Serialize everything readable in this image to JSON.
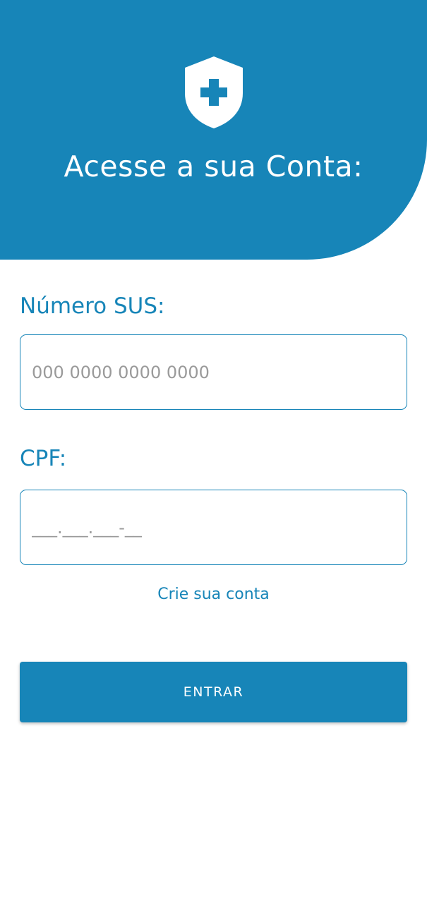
{
  "header": {
    "title": "Acesse a sua Conta:",
    "logo_icon": "shield-plus-icon"
  },
  "form": {
    "sus": {
      "label": "Número SUS:",
      "placeholder": "000 0000 0000 0000",
      "value": ""
    },
    "cpf": {
      "label": "CPF:",
      "placeholder": "___.___.___-__",
      "value": ""
    }
  },
  "create_account_link": "Crie sua conta",
  "submit_button": "ENTRAR",
  "colors": {
    "primary": "#1785b8",
    "background": "#ffffff",
    "placeholder": "#9a9a9a"
  }
}
